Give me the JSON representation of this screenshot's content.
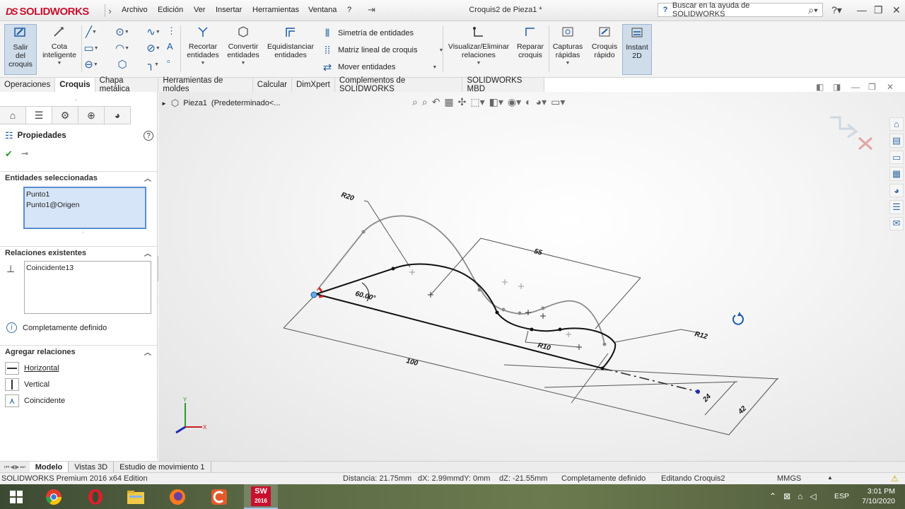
{
  "app": {
    "logo_ds": "DS",
    "logo_text": "SOLIDWORKS",
    "doc_title": "Croquis2 de Pieza1 *"
  },
  "menu": [
    "Archivo",
    "Edición",
    "Ver",
    "Insertar",
    "Herramientas",
    "Ventana",
    "?"
  ],
  "search": {
    "placeholder": "Buscar en la ayuda de SOLIDWORKS"
  },
  "toolbar": {
    "salir": "Salir\ndel\ncroquis",
    "cota": "Cota\ninteligente",
    "recortar": "Recortar\nentidades",
    "convertir": "Convertir\nentidades",
    "equidistanciar": "Equidistanciar\nentidades",
    "simetria": "Simetría de entidades",
    "matriz": "Matriz lineal de croquis",
    "mover": "Mover entidades",
    "visualizar": "Visualizar/Eliminar\nrelaciones",
    "reparar": "Reparar\ncroquis",
    "capturas": "Capturas\nrápidas",
    "croquis_rapido": "Croquis\nrápido",
    "instant2d": "Instant\n2D"
  },
  "tabs": [
    "Operaciones",
    "Croquis",
    "Chapa metálica",
    "Herramientas de moldes",
    "Calcular",
    "DimXpert",
    "Complementos de SOLIDWORKS",
    "SOLIDWORKS MBD"
  ],
  "active_tab": "Croquis",
  "panel": {
    "title": "Propiedades",
    "help": "?",
    "selected_header": "Entidades seleccionadas",
    "selected": [
      "Punto1",
      "Punto1@Origen"
    ],
    "relations_header": "Relaciones existentes",
    "relations": [
      "Coincidente13"
    ],
    "status": "Completamente definido",
    "add_header": "Agregar relaciones",
    "add": [
      "Horizontal",
      "Vertical",
      "Coincidente"
    ]
  },
  "breadcrumb": {
    "part": "Pieza1",
    "config": "(Predeterminado<..."
  },
  "dimensions": {
    "r20": "R20",
    "d55": "55",
    "angle": "60.00°",
    "r10": "R10",
    "r12": "R12",
    "d100": "100",
    "d24": "24",
    "d42": "42"
  },
  "triad": {
    "x": "X",
    "y": "Y"
  },
  "bottom_tabs": [
    "Modelo",
    "Vistas 3D",
    "Estudio de movimiento 1"
  ],
  "status": {
    "edition": "SOLIDWORKS Premium 2016 x64 Edition",
    "distance": "Distancia: 21.75mm",
    "dx": "dX: 2.99mm",
    "dy": "dY: 0mm",
    "dz": "dZ: -21.55mm",
    "defined": "Completamente definido",
    "editing": "Editando Croquis2",
    "units": "MMGS"
  },
  "taskbar": {
    "sw_label": "2016",
    "lang": "ESP",
    "time": "3:01 PM",
    "date": "7/10/2020"
  },
  "colors": {
    "accent": "#1a5aa6",
    "brand": "#c8102e",
    "selection": "#d6e5f7"
  }
}
